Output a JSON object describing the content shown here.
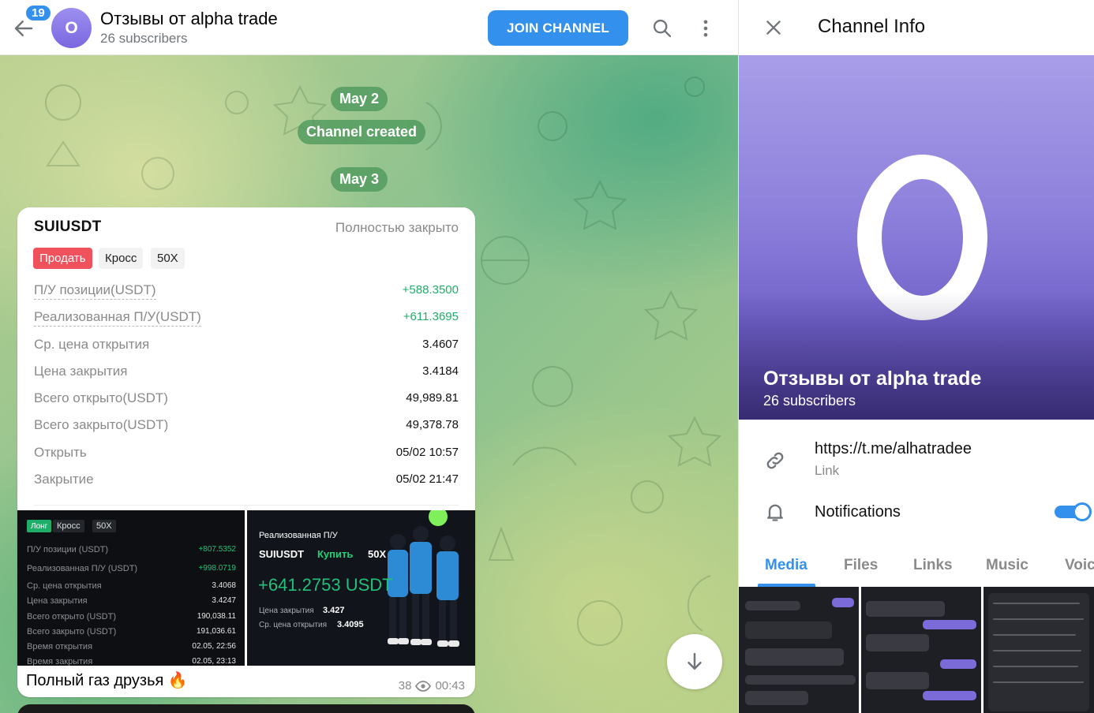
{
  "chat": {
    "unread_count": "19",
    "avatar_letter": "О",
    "title": "Отзывы от alpha trade",
    "subtitle": "26 subscribers",
    "join_label": "JOIN CHANNEL"
  },
  "service": {
    "date1": "May 2",
    "created": "Channel created",
    "date2": "May 3"
  },
  "message": {
    "symbol": "SUIUSDT",
    "status": "Полностью закрыто",
    "tags": [
      "Продать",
      "Кросс",
      "50X"
    ],
    "rows": [
      {
        "label": "П/У позиции(USDT)",
        "value": "+588.3500"
      },
      {
        "label": "Реализованная П/У(USDT)",
        "value": "+611.3695"
      },
      {
        "label": "Ср. цена открытия",
        "value": "3.4607"
      },
      {
        "label": "Цена закрытия",
        "value": "3.4184"
      },
      {
        "label": "Всего открыто(USDT)",
        "value": "49,989.81"
      },
      {
        "label": "Всего закрыто(USDT)",
        "value": "49,378.78"
      },
      {
        "label": "Открыть",
        "value": "05/02 10:57"
      },
      {
        "label": "Закрытие",
        "value": "05/02 21:47"
      }
    ],
    "shot1": {
      "tags": [
        "Лонг",
        "Кросс",
        "50X"
      ],
      "rows": [
        {
          "label": "П/У позиции (USDT)",
          "value": "+807.5352"
        },
        {
          "label": "Реализованная П/У (USDT)",
          "value": "+998.0719"
        },
        {
          "label": "Ср. цена открытия",
          "value": "3.4068"
        },
        {
          "label": "Цена закрытия",
          "value": "3.4247"
        },
        {
          "label": "Всего открыто (USDT)",
          "value": "190,038.11"
        },
        {
          "label": "Всего закрыто (USDT)",
          "value": "191,036.61"
        },
        {
          "label": "Время открытия",
          "value": "02.05, 22:56"
        },
        {
          "label": "Время закрытия",
          "value": "02.05, 23:13"
        }
      ]
    },
    "shot2": {
      "heading": "Реализованная П/У",
      "symbol": "SUIUSDT",
      "side": "Купить",
      "leverage": "50X",
      "pnl": "+641.2753 USDT",
      "close_label": "Цена закрытия",
      "close_value": "3.427",
      "open_label": "Ср. цена открытия",
      "open_value": "3.4095"
    },
    "text": "Полный газ друзья 🔥",
    "views": "38",
    "time": "00:43"
  },
  "info": {
    "title": "Channel Info",
    "avatar_letter": "О",
    "name": "Отзывы от alpha trade",
    "subscribers": "26 subscribers",
    "link": "https://t.me/alhatradee",
    "link_label": "Link",
    "notifications_label": "Notifications",
    "notifications_on": true,
    "tabs": [
      "Media",
      "Files",
      "Links",
      "Music",
      "Voice"
    ]
  },
  "colors": {
    "accent": "#3390ec",
    "sell": "#f0525d",
    "profit": "#1fae6a",
    "avatar": "#8c7fdb"
  }
}
